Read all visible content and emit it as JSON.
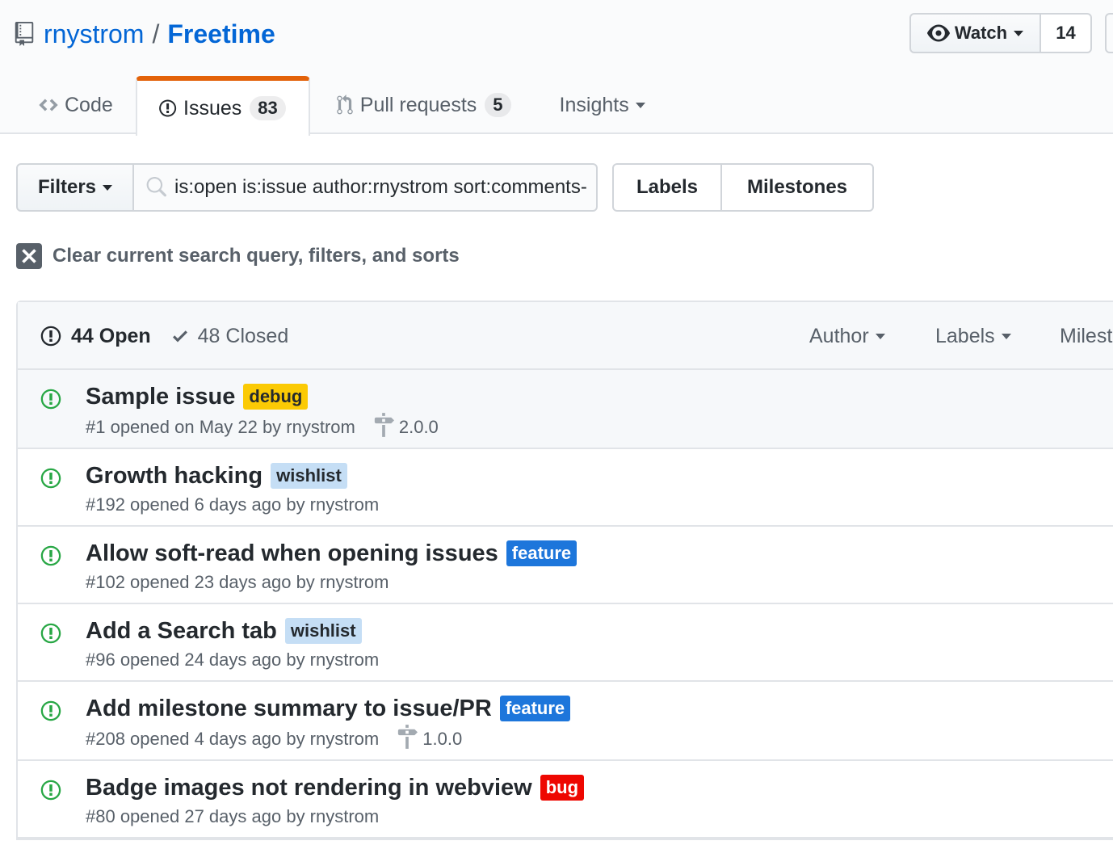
{
  "repo": {
    "owner": "rnystrom",
    "separator": "/",
    "name": "Freetime"
  },
  "watch": {
    "label": "Watch",
    "count": "14"
  },
  "tabs": [
    {
      "label": "Code"
    },
    {
      "label": "Issues",
      "count": "83"
    },
    {
      "label": "Pull requests",
      "count": "5"
    },
    {
      "label": "Insights"
    }
  ],
  "toolbar": {
    "filters_label": "Filters",
    "search_value": "is:open is:issue author:rnystrom sort:comments-desc",
    "labels_label": "Labels",
    "milestones_label": "Milestones"
  },
  "clear": {
    "text": "Clear current search query, filters, and sorts"
  },
  "list_header": {
    "open": "44 Open",
    "closed": "48 Closed",
    "author": "Author",
    "labels": "Labels",
    "milestones": "Milestones"
  },
  "issues": [
    {
      "title": "Sample issue",
      "label": "debug",
      "label_bg": "#fbca04",
      "label_fg": "#24292e",
      "meta": "#1 opened on May 22 by rnystrom",
      "milestone": "2.0.0"
    },
    {
      "title": "Growth hacking",
      "label": "wishlist",
      "label_bg": "#c5def5",
      "label_fg": "#24292e",
      "meta": "#192 opened 6 days ago by rnystrom",
      "milestone": ""
    },
    {
      "title": "Allow soft-read when opening issues",
      "label": "feature",
      "label_bg": "#1d76db",
      "label_fg": "#ffffff",
      "meta": "#102 opened 23 days ago by rnystrom",
      "milestone": ""
    },
    {
      "title": "Add a Search tab",
      "label": "wishlist",
      "label_bg": "#c5def5",
      "label_fg": "#24292e",
      "meta": "#96 opened 24 days ago by rnystrom",
      "milestone": ""
    },
    {
      "title": "Add milestone summary to issue/PR",
      "label": "feature",
      "label_bg": "#1d76db",
      "label_fg": "#ffffff",
      "meta": "#208 opened 4 days ago by rnystrom",
      "milestone": "1.0.0"
    },
    {
      "title": "Badge images not rendering in webview",
      "label": "bug",
      "label_bg": "#ee0701",
      "label_fg": "#ffffff",
      "meta": "#80 opened 27 days ago by rnystrom",
      "milestone": ""
    }
  ],
  "colors": {
    "link": "#0366d6",
    "open_icon": "#28a745",
    "tab_accent": "#e36209",
    "muted": "#586069"
  },
  "icons": [
    "repo-icon",
    "eye-icon",
    "code-icon",
    "issue-opened-icon",
    "git-pull-request-icon",
    "search-icon",
    "x-icon",
    "check-icon",
    "milestone-icon"
  ]
}
